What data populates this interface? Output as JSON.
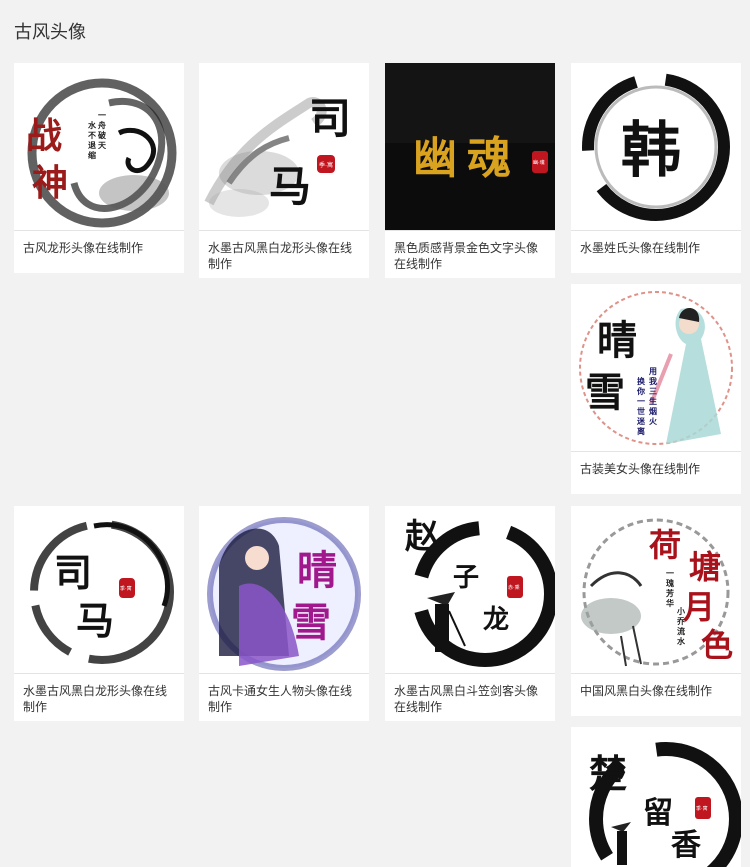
{
  "page": {
    "title": "古风头像"
  },
  "cards": [
    {
      "caption": "古风龙形头像在线制作",
      "art": {
        "big": [
          "战",
          "神"
        ],
        "vertical": [
          "一",
          "舟",
          "破",
          "天",
          "水",
          "不",
          "退",
          "缩"
        ],
        "colors": {
          "big": "#9b1b1b",
          "ink": "#222222"
        }
      }
    },
    {
      "caption": "水墨古风黑白龙形头像在线制作",
      "art": {
        "big": [
          "司",
          "马"
        ],
        "seal": "季·寓"
      }
    },
    {
      "caption": "黑色质感背景金色文字头像在线制作",
      "art": {
        "big": [
          "幽",
          "魂"
        ],
        "seal": "幽·魂",
        "colors": {
          "bg": "#0c0c0c",
          "gold": "#d9a320"
        }
      }
    },
    {
      "caption": "水墨姓氏头像在线制作",
      "art": {
        "big": [
          "韩"
        ]
      }
    },
    {
      "caption": "古装美女头像在线制作",
      "art": {
        "big": [
          "晴",
          "雪"
        ],
        "vertical": [
          "用",
          "我",
          "三",
          "生",
          "烟",
          "火",
          "换",
          "你",
          "一",
          "世",
          "迷",
          "离"
        ]
      }
    },
    {
      "caption": "水墨古风黑白龙形头像在线制作",
      "art": {
        "big": [
          "司",
          "马"
        ],
        "seal": "季·寓"
      }
    },
    {
      "caption": "古风卡通女生人物头像在线制作",
      "art": {
        "big": [
          "晴",
          "雪"
        ],
        "colors": {
          "big": "#a0188c"
        }
      }
    },
    {
      "caption": "水墨古风黑白斗笠剑客头像在线制作",
      "art": {
        "big": [
          "赵",
          "子",
          "龙"
        ],
        "seal": "赤·乘"
      }
    },
    {
      "caption": "中国风黑白头像在线制作",
      "art": {
        "big": [
          "荷",
          "塘",
          "月",
          "色"
        ],
        "vertical": [
          "一",
          "瑰",
          "芳",
          "华",
          "小",
          "乔",
          "流",
          "水"
        ],
        "colors": {
          "big": "#a8121b"
        }
      }
    },
    {
      "caption": "",
      "art": {
        "big": [
          "楚",
          "留",
          "香"
        ],
        "seal": "季·寓"
      }
    }
  ]
}
